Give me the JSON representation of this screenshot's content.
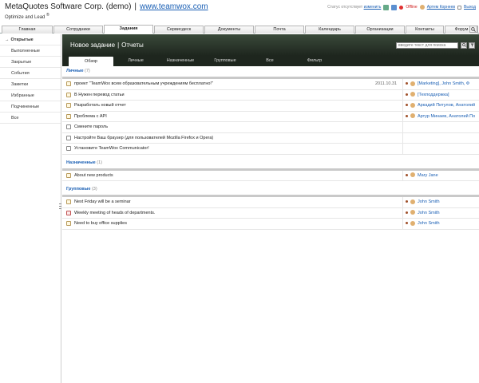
{
  "header": {
    "company": "MetaQuotes Software Corp. (demo)",
    "separator": "|",
    "site": "www.teamwox.com",
    "tagline": "Optimize and Lead",
    "tagline_mark": "®",
    "status_note": "Статус отсутствует",
    "status_action": "изменить",
    "status_icons": [
      "notes-icon",
      "home-icon"
    ],
    "offline": "Offline",
    "user": "Артем Корнеев",
    "logout": "Выход"
  },
  "nav": {
    "tabs": [
      "Главная",
      "Сотрудники",
      "Задания",
      "Сервисдеск",
      "Документы",
      "Почта",
      "Календарь",
      "Организации",
      "Контакты",
      "Форум"
    ],
    "active": "Задания",
    "search_icon": "search-icon"
  },
  "sidebar": {
    "items": [
      "Открытые",
      "Выполненные",
      "Закрытые",
      "События",
      "Заметки",
      "Избранные",
      "Подчиненные",
      "Все"
    ],
    "active": "Открытые",
    "active_marker": "→"
  },
  "toolbar": {
    "new_task": "Новое задание",
    "separator": "|",
    "reports": "Отчеты",
    "search_placeholder": "введите текст для поиска",
    "search_icon": "search-icon",
    "filter_icon": "filter-icon"
  },
  "subtabs": {
    "items": [
      "Обзор",
      "Личные",
      "Назначенные",
      "Групповые",
      "Все",
      "Фильтр"
    ],
    "active": "Обзор"
  },
  "groups": [
    {
      "name": "Личные",
      "count": "(7)",
      "rows": [
        {
          "text": "проект \"TeamWox всем образовательным учреждениям бесплатно!\"",
          "date": "2011.10.31",
          "assignee": "[Marketing], John Smith, Ф"
        },
        {
          "text": "В Нужен перевод статьи",
          "date": "",
          "assignee": "[Техподдержка]"
        },
        {
          "text": "Разработать новый отчет",
          "date": "",
          "assignee": "Аркадий Питулов, Анатолий"
        },
        {
          "text": "Проблема с API",
          "date": "",
          "assignee": "Артур Минаев, Анатолий По"
        },
        {
          "text": "Смените пароль",
          "date": "",
          "assignee": ""
        },
        {
          "text": "Настройте Ваш браузер (для пользователей Mozilla Firefox и Opera)",
          "date": "",
          "assignee": ""
        },
        {
          "text": "Установите TeamWox Communicator!",
          "date": "",
          "assignee": ""
        }
      ]
    },
    {
      "name": "Назначенные",
      "count": "(1)",
      "rows": [
        {
          "text": "About new products",
          "date": "",
          "assignee": "Mary Jane"
        }
      ]
    },
    {
      "name": "Групповые",
      "count": "(3)",
      "rows": [
        {
          "text": "Next Friday will be a seminar",
          "date": "",
          "assignee": "John Smith"
        },
        {
          "text": "Weekly meeting of heads of departments.",
          "date": "",
          "assignee": "John Smith"
        },
        {
          "text": "Need to buy office supplies",
          "date": "",
          "assignee": "John Smith"
        }
      ]
    }
  ],
  "colors": {
    "link": "#1a5fb4",
    "toolbar_bg": "#1e261e",
    "offline": "#e03030"
  }
}
